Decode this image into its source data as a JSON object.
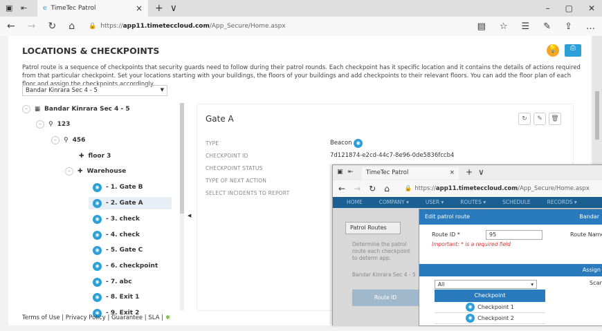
{
  "browser": {
    "tab_title": "TimeTec Patrol",
    "url_prefix": "https://",
    "url_domain": "app11.timeteccloud.com",
    "url_path": "/App_Secure/Home.aspx",
    "plus": "+",
    "caret": "∨",
    "close": "×"
  },
  "page": {
    "title": "LOCATIONS & CHECKPOINTS",
    "description": "Patrol route is a sequence of checkpoints that security guards need to follow during their patrol rounds. Each checkpoint has it specific location and it contains the details of actions required from that particular checkpoint. Set your locations starting with your buildings, the floors of your buildings and add checkpoints to their relevant floors. You can add the floor plan of each floor and assign the checkpoints accordingly.",
    "site_select": "Bandar Kinrara Sec 4 - 5"
  },
  "tree": {
    "root": "Bandar Kinrara Sec 4 - 5",
    "n123": "123",
    "n456": "456",
    "floor3": "floor 3",
    "warehouse": "Warehouse",
    "cps": [
      "- 1. Gate B",
      "- 2. Gate A",
      "- 3. check",
      "- 4. check",
      "- 5. Gate C",
      "- 6. checkpoint",
      "- 7. abc",
      "- 8. Exit 1",
      "- 9. Exit 2"
    ]
  },
  "detail": {
    "name": "Gate A",
    "labels": [
      "TYPE",
      "CHECKPOINT ID",
      "CHECKPOINT STATUS",
      "TYPE OF NEXT ACTION",
      "SELECT INCIDENTS TO REPORT"
    ],
    "type": "Beacon",
    "checkpoint_id": "7d121874-e2cd-44c7-8e96-0de5836fccb4"
  },
  "footer": {
    "terms": "Terms of Use",
    "privacy": "Privacy Policy",
    "guarantee": "Guarantee",
    "sla": "SLA",
    "sep": "|"
  },
  "inner": {
    "tab_title": "TimeTec Patrol",
    "menu": [
      "HOME",
      "COMPANY ▾",
      "USER ▾",
      "ROUTES ▾",
      "SCHEDULE",
      "RECORDS ▾"
    ],
    "patrol_tab": "Patrol Routes",
    "bg_text": "Determine the patrol route each checkpoint to determ app.",
    "bg_select": "Bandar Kinrara Sec 4 - 5",
    "route_col": "Route ID",
    "modal_title": "Edit patrol route",
    "modal_right": "Bandar",
    "route_label": "Route ID *",
    "route_value": "95",
    "route_name": "Route Name",
    "important": "Important: * is a required field",
    "assign": "Assign",
    "filter": "All",
    "scan": "Scan",
    "cp_header": "Checkpoint",
    "cps": [
      "Checkpoint 1",
      "Checkpoint 2"
    ]
  }
}
